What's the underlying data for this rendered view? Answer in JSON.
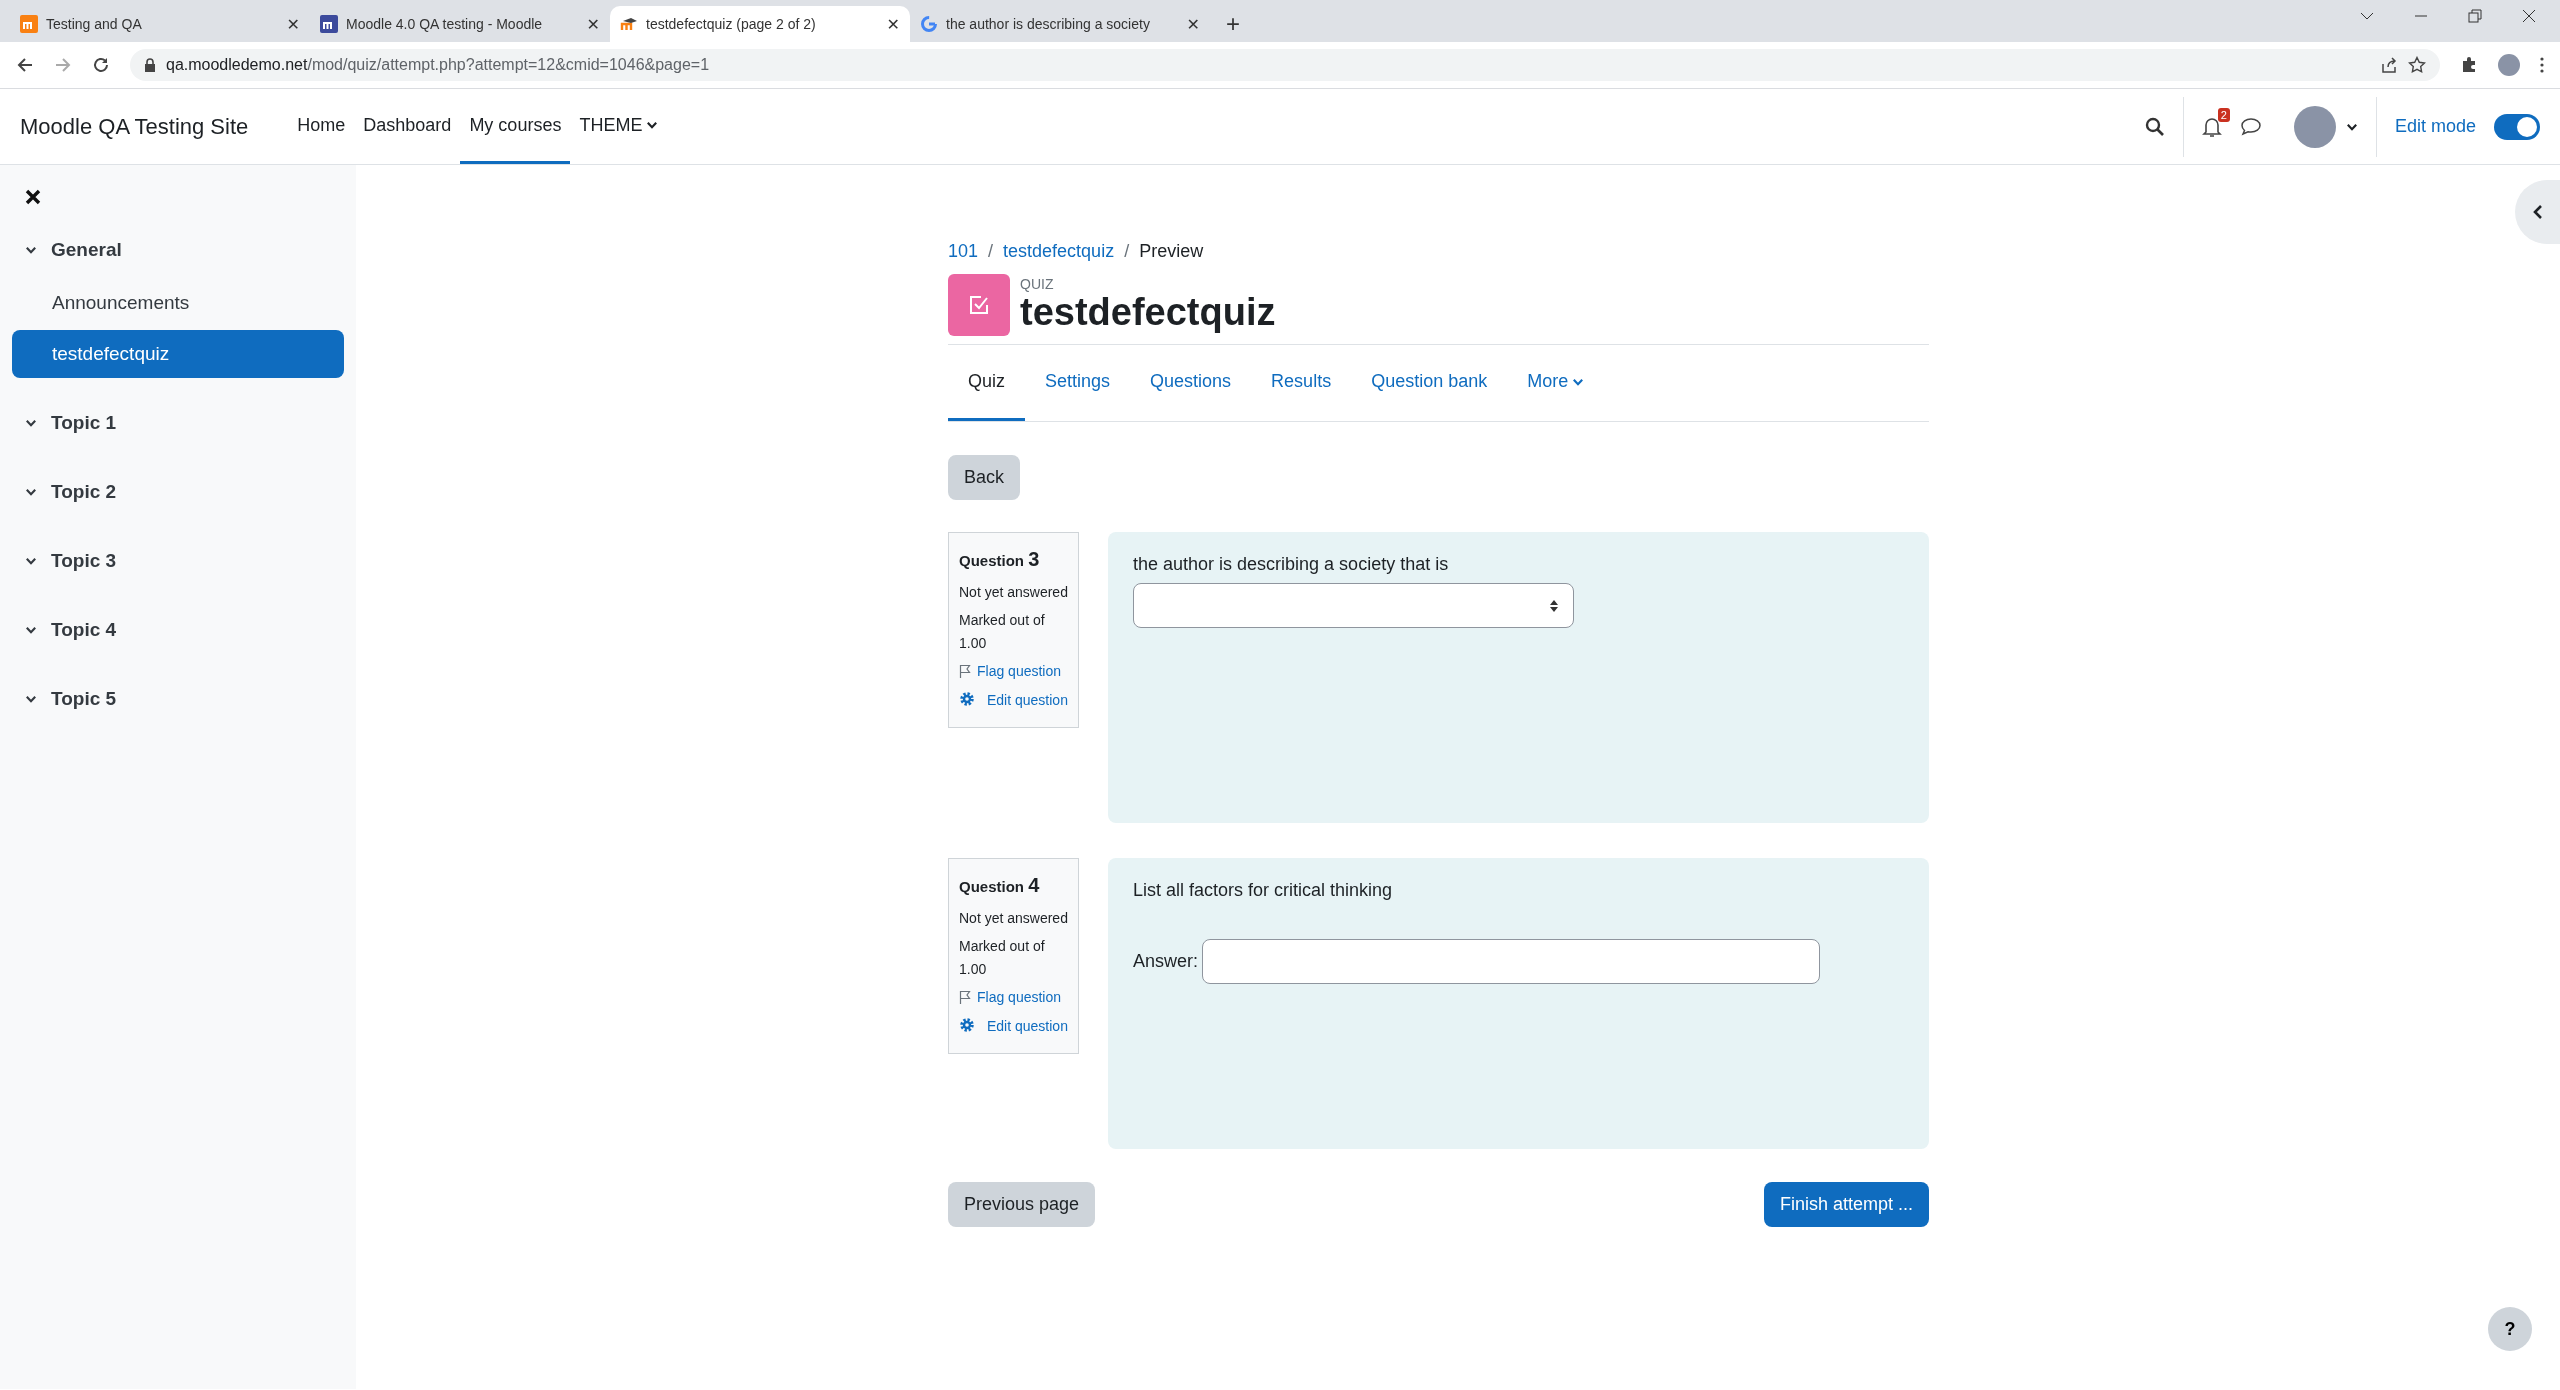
{
  "browser": {
    "tabs": [
      {
        "title": "Testing and QA",
        "close": "✕",
        "selected": false
      },
      {
        "title": "Moodle 4.0 QA testing - Moodle",
        "close": "✕",
        "selected": false
      },
      {
        "title": "testdefectquiz (page 2 of 2)",
        "close": "✕",
        "selected": true
      },
      {
        "title": "the author is describing a society",
        "close": "✕",
        "selected": false
      }
    ],
    "new_tab": "+",
    "url_host": "qa.moodledemo.net",
    "url_path": "/mod/quiz/attempt.php?attempt=12&cmid=1046&page=1"
  },
  "navbar": {
    "site_name": "Moodle QA Testing Site",
    "items": [
      {
        "label": "Home",
        "selected": false,
        "dropdown": false
      },
      {
        "label": "Dashboard",
        "selected": false,
        "dropdown": false
      },
      {
        "label": "My courses",
        "selected": true,
        "dropdown": false
      },
      {
        "label": "THEME",
        "selected": false,
        "dropdown": true
      }
    ],
    "notification_count": "2",
    "edit_mode": {
      "label": "Edit mode",
      "on": true
    }
  },
  "sidebar": {
    "sections": [
      {
        "title": "General",
        "expanded": true,
        "children": [
          {
            "label": "Announcements",
            "selected": false
          },
          {
            "label": "testdefectquiz",
            "selected": true
          }
        ]
      },
      {
        "title": "Topic 1",
        "expanded": true
      },
      {
        "title": "Topic 2",
        "expanded": true
      },
      {
        "title": "Topic 3",
        "expanded": true
      },
      {
        "title": "Topic 4",
        "expanded": true
      },
      {
        "title": "Topic 5",
        "expanded": true
      }
    ]
  },
  "breadcrumb": [
    {
      "label": "101",
      "link": true
    },
    {
      "separator_before": "/",
      "label": "testdefectquiz",
      "link": true
    },
    {
      "separator_before": "/",
      "label": "Preview",
      "link": false
    }
  ],
  "module_type": "QUIZ",
  "title": "testdefectquiz",
  "tabs": [
    {
      "label": "Quiz",
      "selected": true,
      "dropdown": false
    },
    {
      "label": "Settings",
      "selected": false,
      "dropdown": false
    },
    {
      "label": "Questions",
      "selected": false,
      "dropdown": false
    },
    {
      "label": "Results",
      "selected": false,
      "dropdown": false
    },
    {
      "label": "Question bank",
      "selected": false,
      "dropdown": false
    },
    {
      "label": "More",
      "selected": false,
      "dropdown": true
    }
  ],
  "back_button": "Back",
  "questions": [
    {
      "label": "Question",
      "number": "3",
      "status": "Not yet answered",
      "marks": "Marked out of 1.00",
      "flag": "Flag question",
      "edit": "Edit question",
      "text": "the author is describing a society that is",
      "kind": "select"
    },
    {
      "label": "Question",
      "number": "4",
      "status": "Not yet answered",
      "marks": "Marked out of 1.00",
      "flag": "Flag question",
      "edit": "Edit question",
      "text": "List all factors for critical thinking",
      "kind": "text",
      "answer_label": "Answer:"
    }
  ],
  "previous_button": "Previous page",
  "finish_button": "Finish attempt ...",
  "help_button": "?"
}
